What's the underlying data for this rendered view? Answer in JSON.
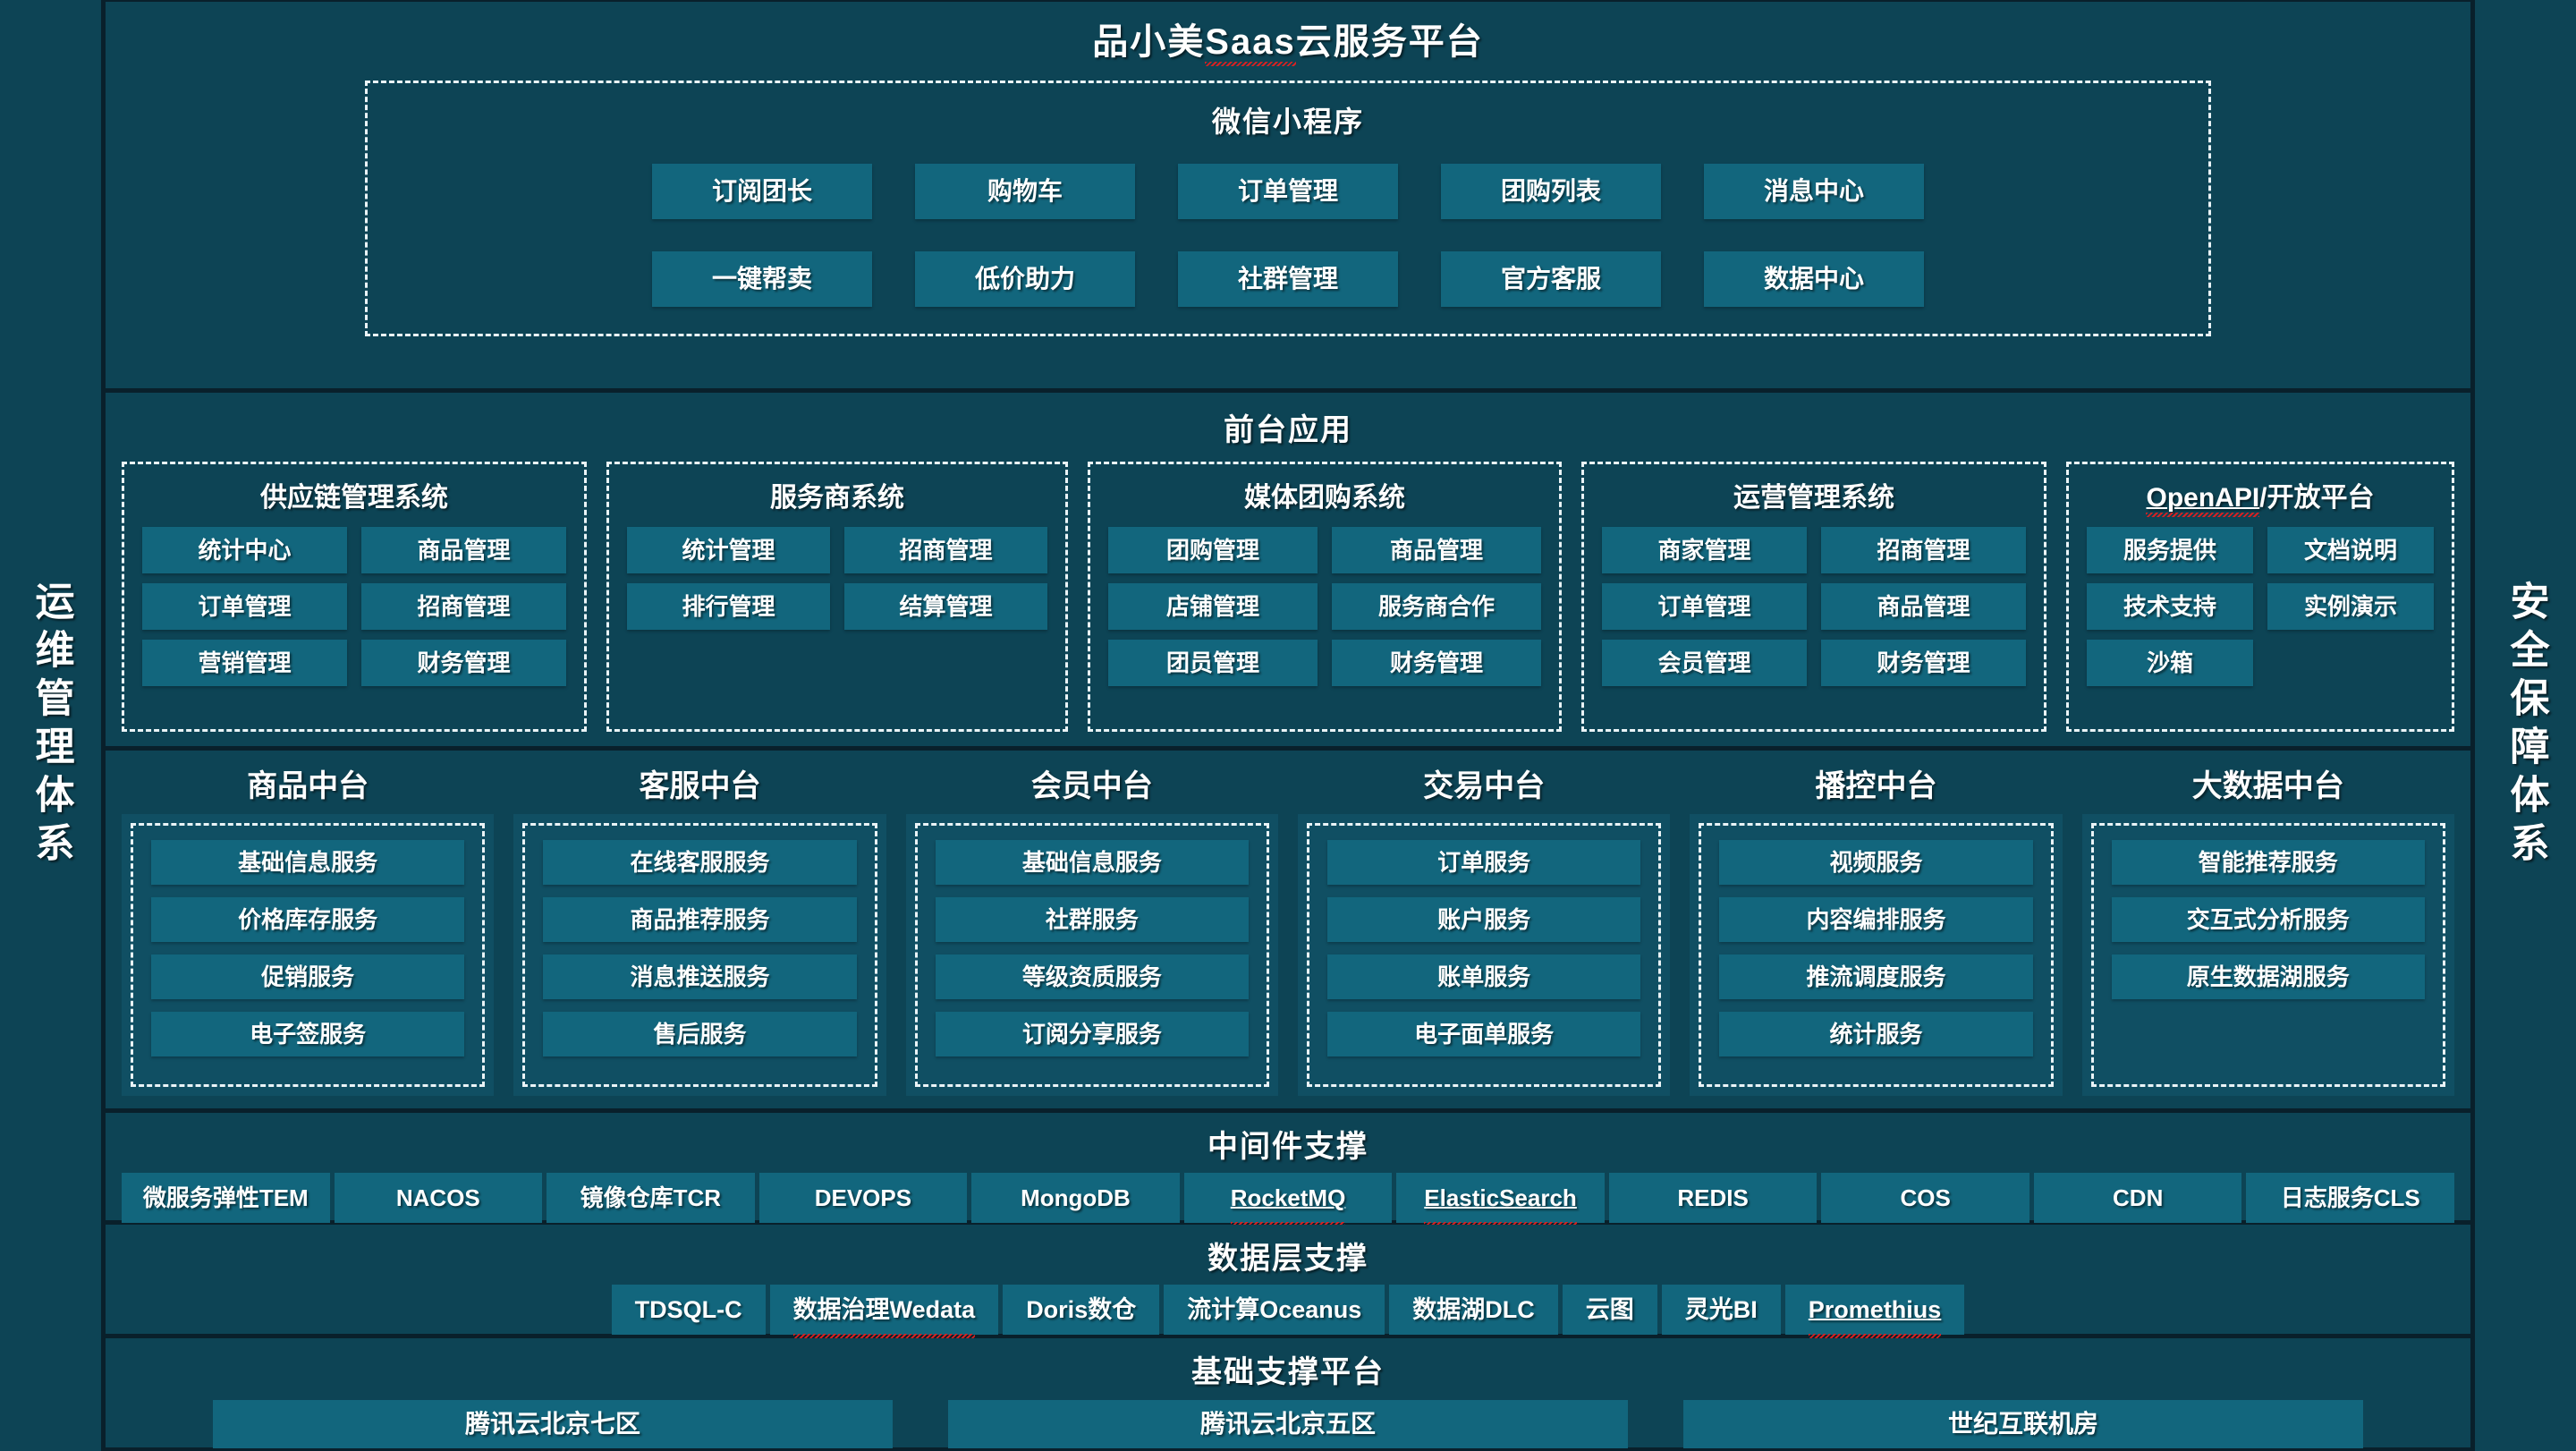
{
  "title": "品小美Saas云服务平台",
  "title_parts": {
    "pre": "品小美",
    "flagged": "Saas",
    "post": "云服务平台"
  },
  "colors": {
    "page_bg": "#0d4455",
    "band_gap": "#09202b",
    "chip_bg": "#12667d",
    "mid_body_bg": "#104f63",
    "dash_border": "#eaf4f7",
    "text": "#ffffff",
    "spellcheck_red": "#e02020"
  },
  "left_rail": {
    "label": "运维管理体系"
  },
  "right_rail": {
    "label": "安全保障体系"
  },
  "mini_program": {
    "title": "微信小程序",
    "items": [
      "订阅团长",
      "购物车",
      "订单管理",
      "团购列表",
      "消息中心",
      "一键帮卖",
      "低价助力",
      "社群管理",
      "官方客服",
      "数据中心"
    ]
  },
  "front_apps": {
    "title": "前台应用",
    "systems": [
      {
        "title": "供应链管理系统",
        "flagged": false,
        "items": [
          "统计中心",
          "商品管理",
          "订单管理",
          "招商管理",
          "营销管理",
          "财务管理"
        ]
      },
      {
        "title": "服务商系统",
        "flagged": false,
        "items": [
          "统计管理",
          "招商管理",
          "排行管理",
          "结算管理"
        ]
      },
      {
        "title": "媒体团购系统",
        "flagged": false,
        "items": [
          "团购管理",
          "商品管理",
          "店铺管理",
          "服务商合作",
          "团员管理",
          "财务管理"
        ]
      },
      {
        "title": "运营管理系统",
        "flagged": false,
        "items": [
          "商家管理",
          "招商管理",
          "订单管理",
          "商品管理",
          "会员管理",
          "财务管理"
        ]
      },
      {
        "title": "OpenAPI/开放平台",
        "title_pre": "OpenAPI",
        "title_post": "/开放平台",
        "flagged": true,
        "items": [
          "服务提供",
          "文档说明",
          "技术支持",
          "实例演示",
          "沙箱"
        ]
      }
    ]
  },
  "middle_platforms": {
    "platforms": [
      {
        "title": "商品中台",
        "items": [
          "基础信息服务",
          "价格库存服务",
          "促销服务",
          "电子签服务"
        ]
      },
      {
        "title": "客服中台",
        "items": [
          "在线客服服务",
          "商品推荐服务",
          "消息推送服务",
          "售后服务"
        ]
      },
      {
        "title": "会员中台",
        "items": [
          "基础信息服务",
          "社群服务",
          "等级资质服务",
          "订阅分享服务"
        ]
      },
      {
        "title": "交易中台",
        "items": [
          "订单服务",
          "账户服务",
          "账单服务",
          "电子面单服务"
        ]
      },
      {
        "title": "播控中台",
        "items": [
          "视频服务",
          "内容编排服务",
          "推流调度服务",
          "统计服务"
        ]
      },
      {
        "title": "大数据中台",
        "items": [
          "智能推荐服务",
          "交互式分析服务",
          "原生数据湖服务"
        ]
      }
    ]
  },
  "middleware": {
    "title": "中间件支撑",
    "items": [
      {
        "label": "微服务弹性TEM",
        "flagged": false
      },
      {
        "label": "NACOS",
        "flagged": false
      },
      {
        "label": "镜像仓库TCR",
        "flagged": false
      },
      {
        "label": "DEVOPS",
        "flagged": false
      },
      {
        "label": "MongoDB",
        "flagged": false
      },
      {
        "label": "RocketMQ",
        "flagged": true
      },
      {
        "label": "ElasticSearch",
        "flagged": true
      },
      {
        "label": "REDIS",
        "flagged": false
      },
      {
        "label": "COS",
        "flagged": false
      },
      {
        "label": "CDN",
        "flagged": false
      },
      {
        "label": "日志服务CLS",
        "flagged": false
      }
    ]
  },
  "data_layer": {
    "title": "数据层支撑",
    "items": [
      {
        "label": "TDSQL-C",
        "flagged": false
      },
      {
        "label": "数据治理Wedata",
        "flagged": true
      },
      {
        "label": "Doris数仓",
        "flagged": false
      },
      {
        "label": "流计算Oceanus",
        "flagged": false
      },
      {
        "label": "数据湖DLC",
        "flagged": false
      },
      {
        "label": "云图",
        "flagged": false
      },
      {
        "label": "灵光BI",
        "flagged": false
      },
      {
        "label": "Promethius",
        "flagged": true
      }
    ]
  },
  "infrastructure": {
    "title": "基础支撑平台",
    "items": [
      "腾讯云北京七区",
      "腾讯云北京五区",
      "世纪互联机房"
    ]
  }
}
